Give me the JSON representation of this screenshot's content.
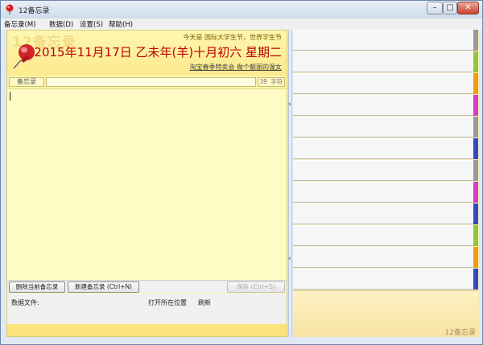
{
  "window": {
    "title": "12备忘录",
    "min_glyph": "–",
    "max_glyph": "□",
    "close_glyph": "✕"
  },
  "menu": {
    "items": [
      {
        "label": "备忘录(M)"
      },
      {
        "label": "数据(D)"
      },
      {
        "label": "设置(S)"
      },
      {
        "label": "帮助(H)"
      }
    ]
  },
  "header": {
    "watermark": "12备忘录",
    "festival": "今天是 国际大学生节，世界学生节",
    "date": "2015年11月17日 乙未年(羊)十月初六 星期二",
    "ad_link": "淘宝春季特卖会 做个靓丽的渥女"
  },
  "editor": {
    "field_label": "备忘录",
    "title_value": "",
    "char_count": "39 字符",
    "content": ""
  },
  "buttons": {
    "delete": "删除当前备忘录",
    "new": "新建备忘录 (Ctrl+N)",
    "save": "保存 (Ctrl+S)"
  },
  "datafile": {
    "label": "数据文件:",
    "open_location": "打开所在位置",
    "refresh": "刷新"
  },
  "splitter": {
    "collapse_glyph": "›",
    "expand_glyph": "‹"
  },
  "right": {
    "slots": [
      {
        "tab_color": "#9a9a9a"
      },
      {
        "tab_color": "#8ec63f"
      },
      {
        "tab_color": "#f39c12"
      },
      {
        "tab_color": "#d53fc8"
      },
      {
        "tab_color": "#9a9a9a"
      },
      {
        "tab_color": "#3347c8"
      },
      {
        "tab_color": "#9a9a9a"
      },
      {
        "tab_color": "#d53fc8"
      },
      {
        "tab_color": "#3347c8"
      },
      {
        "tab_color": "#8ec63f"
      },
      {
        "tab_color": "#f39c12"
      },
      {
        "tab_color": "#3347c8"
      }
    ],
    "brand": "12备忘录"
  },
  "colors": {
    "accent_date": "#bb0000",
    "paper": "#fffbc4"
  }
}
